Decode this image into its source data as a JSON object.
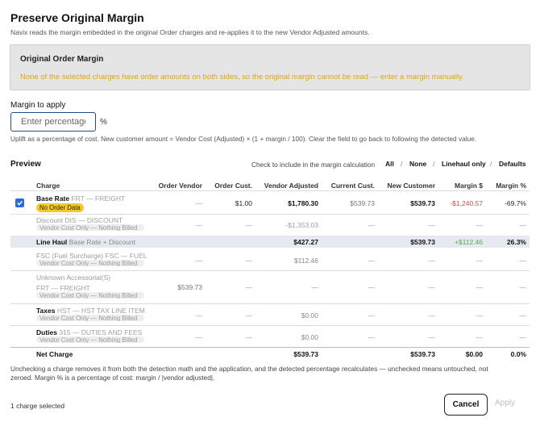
{
  "dialog": {
    "title": "Preserve Original Margin",
    "subtitle": "Navix reads the margin embedded in the original Order charges and re-applies it to the new Vendor Adjusted amounts."
  },
  "banner": {
    "title": "Original Order Margin",
    "message": "None of the selected charges have order amounts on both sides, so the original margin cannot be read — enter a margin manually.",
    "message_color": "#e0a800"
  },
  "margin": {
    "label": "Margin to apply",
    "placeholder": "Enter percentage",
    "value": "",
    "unit": "%",
    "help": "Uplift as a percentage of cost. New customer amount = Vendor Cost (Adjusted) × (1 + margin / 100). Clear the field to go back to following the detected value."
  },
  "preview": {
    "label": "Preview",
    "check_hint": "Check to include in the margin calculation",
    "filters": [
      "All",
      "None",
      "Linehaul only",
      "Defaults"
    ],
    "separator": "/"
  },
  "table": {
    "headers": {
      "charge": "Charge",
      "order_vendor": "Order Vendor",
      "order_cust": "Order Cust.",
      "vendor_adjusted": "Vendor Adjusted",
      "current_cust": "Current Cust.",
      "new_customer": "New Customer",
      "margin_dollar": "Margin $",
      "margin_pct": "Margin %"
    },
    "rows": [
      {
        "name": "Base Rate",
        "code": "FRT — FREIGHT",
        "tag": "No Order Data",
        "order_vendor": "—",
        "order_cust": "$1.00",
        "vendor_adjusted": "$1,780.30",
        "current_cust": "$539.73",
        "new_customer": "$539.73",
        "margin_dollar": "-$1,240.57",
        "margin_pct": "-69.7%"
      },
      {
        "name": "Discount",
        "code": "DIS — DISCOUNT",
        "tag": "Vendor Cost Only — Nothing Billed",
        "order_vendor": "—",
        "order_cust": "—",
        "vendor_adjusted": "-$1,353.03",
        "current_cust": "—",
        "new_customer": "—",
        "margin_dollar": "—",
        "margin_pct": "—"
      },
      {
        "name": "Line Haul",
        "code": "Base Rate + Discount",
        "vendor_adjusted": "$427.27",
        "new_customer": "$539.73",
        "margin_dollar": "+$112.46",
        "margin_pct": "26.3%"
      },
      {
        "name": "FSC (Fuel Surcharge)",
        "code": "FSC — FUEL",
        "tag": "Vendor Cost Only — Nothing Billed",
        "order_vendor": "—",
        "order_cust": "—",
        "vendor_adjusted": "$112.46",
        "current_cust": "—",
        "new_customer": "—",
        "margin_dollar": "—",
        "margin_pct": "—"
      },
      {
        "name": "Unknown Accessorial(S)",
        "code": "FRT — FREIGHT",
        "tag": "Vendor Cost Only — Nothing Billed",
        "order_vendor": "$539.73",
        "order_cust": "—",
        "vendor_adjusted": "—",
        "current_cust": "—",
        "new_customer": "—",
        "margin_dollar": "—",
        "margin_pct": "—"
      },
      {
        "name": "Taxes",
        "code": "HST — HST TAX LINE ITEM",
        "tag": "Vendor Cost Only — Nothing Billed",
        "order_vendor": "—",
        "order_cust": "—",
        "vendor_adjusted": "$0.00",
        "current_cust": "—",
        "new_customer": "—",
        "margin_dollar": "—",
        "margin_pct": "—"
      },
      {
        "name": "Duties",
        "code": "315 — DUTIES AND FEES",
        "tag": "Vendor Cost Only — Nothing Billed",
        "order_vendor": "—",
        "order_cust": "—",
        "vendor_adjusted": "$0.00",
        "current_cust": "—",
        "new_customer": "—",
        "margin_dollar": "—",
        "margin_pct": "—"
      }
    ],
    "total": {
      "name": "Net Charge",
      "vendor_adjusted": "$539.73",
      "new_customer": "$539.73",
      "margin_dollar": "$0.00",
      "margin_pct": "0.0%"
    }
  },
  "footer": {
    "note": "Unchecking a charge removes it from both the detection math and the application, and the detected percentage recalculates — unchecked means untouched, not zeroed. Margin % is a percentage of cost: margin / |vendor adjusted|.",
    "selected": "1 charge selected",
    "cancel": "Cancel",
    "apply": "Apply"
  },
  "colors": {
    "accent": "#2a6dd6",
    "negative": "#d64545",
    "positive": "#4caf50",
    "warning": "#f7c928"
  }
}
